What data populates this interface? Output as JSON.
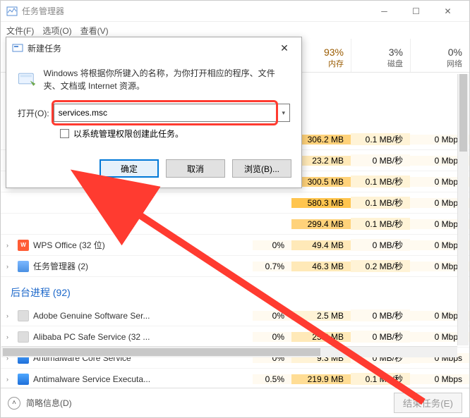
{
  "window": {
    "title": "任务管理器",
    "menu": {
      "file": "文件(F)",
      "options": "选项(O)",
      "view": "查看(V)"
    }
  },
  "columns": {
    "mem": {
      "pct": "93%",
      "label": "内存"
    },
    "disk": {
      "pct": "3%",
      "label": "磁盘"
    },
    "net": {
      "pct": "0%",
      "label": "网络"
    }
  },
  "rows": [
    {
      "name": "",
      "cpu": "",
      "mem": "306.2 MB",
      "disk": "0.1 MB/秒",
      "net": "0 Mbps",
      "h_mem": 4,
      "h_disk": 1,
      "h_net": 0
    },
    {
      "name": "",
      "cpu": "",
      "mem": "23.2 MB",
      "disk": "0 MB/秒",
      "net": "0 Mbps",
      "h_mem": 2,
      "h_disk": 0,
      "h_net": 0
    },
    {
      "name": "",
      "cpu": "",
      "mem": "300.5 MB",
      "disk": "0.1 MB/秒",
      "net": "0 Mbps",
      "h_mem": 4,
      "h_disk": 1,
      "h_net": 0
    },
    {
      "name": "",
      "cpu": "",
      "mem": "580.3 MB",
      "disk": "0.1 MB/秒",
      "net": "0 Mbps",
      "h_mem": 5,
      "h_disk": 1,
      "h_net": 0
    },
    {
      "name": "",
      "cpu": "",
      "mem": "299.4 MB",
      "disk": "0.1 MB/秒",
      "net": "0 Mbps",
      "h_mem": 4,
      "h_disk": 1,
      "h_net": 0
    },
    {
      "name": "WPS Office (32 位)",
      "cpu": "0%",
      "mem": "49.4 MB",
      "disk": "0 MB/秒",
      "net": "0 Mbps",
      "icon": "wps",
      "h_mem": 2,
      "h_disk": 0,
      "h_net": 0
    },
    {
      "name": "任务管理器 (2)",
      "cpu": "0.7%",
      "mem": "46.3 MB",
      "disk": "0.2 MB/秒",
      "net": "0 Mbps",
      "icon": "tm",
      "h_mem": 2,
      "h_disk": 1,
      "h_net": 0
    }
  ],
  "group": {
    "title": "后台进程 (92)"
  },
  "bgrows": [
    {
      "name": "Adobe Genuine Software Ser...",
      "cpu": "0%",
      "mem": "2.5 MB",
      "disk": "0 MB/秒",
      "net": "0 Mbps",
      "icon": "adobe",
      "h_mem": 1,
      "h_disk": 0,
      "h_net": 0
    },
    {
      "name": "Alibaba PC Safe Service (32 ...",
      "cpu": "0%",
      "mem": "25.0 MB",
      "disk": "0 MB/秒",
      "net": "0 Mbps",
      "icon": "ali",
      "h_mem": 2,
      "h_disk": 0,
      "h_net": 0
    },
    {
      "name": "Antimalware Core Service",
      "cpu": "0%",
      "mem": "9.3 MB",
      "disk": "0 MB/秒",
      "net": "0 Mbps",
      "icon": "am",
      "h_mem": 1,
      "h_disk": 0,
      "h_net": 0
    },
    {
      "name": "Antimalware Service Executa...",
      "cpu": "0.5%",
      "mem": "219.9 MB",
      "disk": "0.1 MB/秒",
      "net": "0 Mbps",
      "icon": "am",
      "h_mem": 3,
      "h_disk": 1,
      "h_net": 0
    }
  ],
  "footer": {
    "brief": "简略信息(D)",
    "end": "结束任务(E)"
  },
  "dialog": {
    "title": "新建任务",
    "desc": "Windows 将根据你所键入的名称，为你打开相应的程序、文件夹、文档或 Internet 资源。",
    "open_label": "打开(O):",
    "value": "services.msc",
    "admin": "以系统管理权限创建此任务。",
    "ok": "确定",
    "cancel": "取消",
    "browse": "浏览(B)..."
  }
}
